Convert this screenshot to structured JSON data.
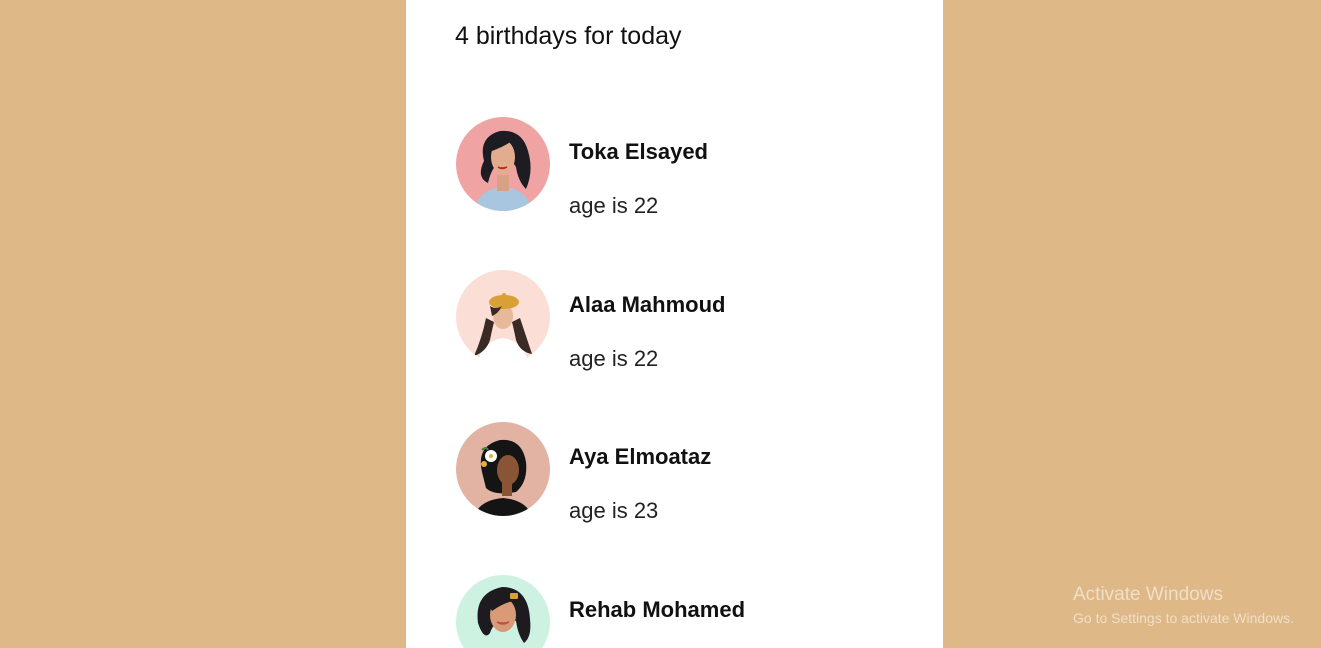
{
  "heading": "4 birthdays for today",
  "people": [
    {
      "name": "Toka Elsayed",
      "age_text": "age is 22",
      "avatar_icon": "woman-avatar-icon",
      "avatar_bg": "#f0a3a3"
    },
    {
      "name": "Alaa Mahmoud",
      "age_text": "age is 22",
      "avatar_icon": "woman-beret-avatar-icon",
      "avatar_bg": "#fbded6"
    },
    {
      "name": "Aya Elmoataz",
      "age_text": "age is 23",
      "avatar_icon": "woman-flower-avatar-icon",
      "avatar_bg": "#e2b2a3"
    },
    {
      "name": "Rehab Mohamed",
      "age_text": "",
      "avatar_icon": "woman-clip-avatar-icon",
      "avatar_bg": "#cdf2e2"
    }
  ],
  "watermark": {
    "title": "Activate Windows",
    "subtitle": "Go to Settings to activate Windows."
  },
  "colors": {
    "page_background": "#deb887",
    "card_background": "#ffffff"
  }
}
